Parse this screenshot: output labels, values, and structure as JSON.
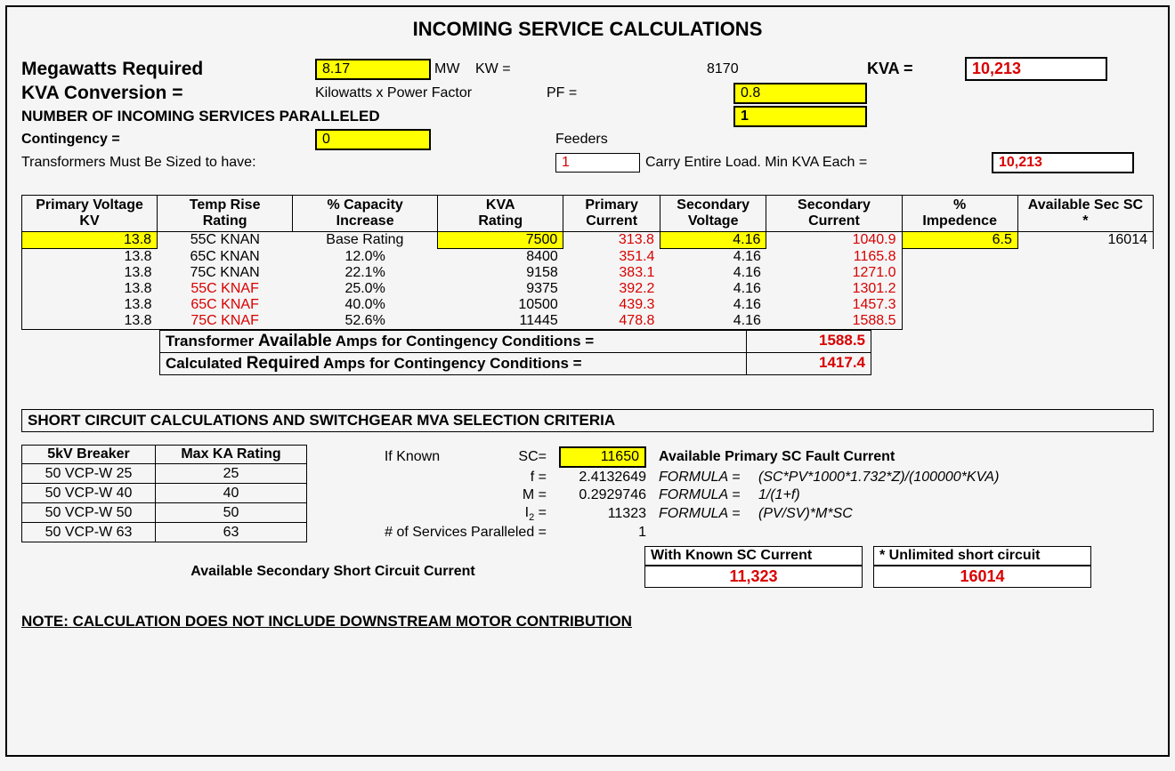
{
  "title": "INCOMING SERVICE CALCULATIONS",
  "inputs": {
    "mw_label": "Megawatts Required",
    "mw_value": "8.17",
    "mw_unit": "MW",
    "kw_label": "KW =",
    "kw_value": "8170",
    "kva_label": "KVA =",
    "kva_value": "10,213",
    "kva_conv_label": "KVA Conversion =",
    "kva_conv_formula": "Kilowatts x Power Factor",
    "pf_label": "PF =",
    "pf_value": "0.8",
    "parallel_label": "NUMBER OF INCOMING SERVICES PARALLELED",
    "parallel_value": "1",
    "contingency_label": "Contingency =",
    "contingency_value": "0",
    "feeders_label": "Feeders",
    "sized_label": "Transformers Must Be Sized to have:",
    "sized_value": "1",
    "sized_rest": "Carry Entire Load. Min KVA Each =",
    "sized_kva": "10,213"
  },
  "tfm": {
    "headers": [
      "Primary Voltage KV",
      "Temp Rise Rating",
      "% Capacity Increase",
      "KVA Rating",
      "Primary Current",
      "Secondary Voltage",
      "Secondary Current",
      "% Impedence",
      "Available Sec SC *"
    ],
    "rows": [
      {
        "pv": "13.8",
        "temp": "55C KNAN",
        "temp_red": false,
        "cap": "Base Rating",
        "kva": "7500",
        "pc": "313.8",
        "sv": "4.16",
        "sc": "1040.9",
        "imp": "6.5",
        "avail": "16014",
        "first": true
      },
      {
        "pv": "13.8",
        "temp": "65C KNAN",
        "temp_red": false,
        "cap": "12.0%",
        "kva": "8400",
        "pc": "351.4",
        "sv": "4.16",
        "sc": "1165.8"
      },
      {
        "pv": "13.8",
        "temp": "75C KNAN",
        "temp_red": false,
        "cap": "22.1%",
        "kva": "9158",
        "pc": "383.1",
        "sv": "4.16",
        "sc": "1271.0"
      },
      {
        "pv": "13.8",
        "temp": "55C KNAF",
        "temp_red": true,
        "cap": "25.0%",
        "kva": "9375",
        "pc": "392.2",
        "sv": "4.16",
        "sc": "1301.2"
      },
      {
        "pv": "13.8",
        "temp": "65C KNAF",
        "temp_red": true,
        "cap": "40.0%",
        "kva": "10500",
        "pc": "439.3",
        "sv": "4.16",
        "sc": "1457.3"
      },
      {
        "pv": "13.8",
        "temp": "75C KNAF",
        "temp_red": true,
        "cap": "52.6%",
        "kva": "11445",
        "pc": "478.8",
        "sv": "4.16",
        "sc": "1588.5"
      }
    ],
    "sum1_label_a": "Transformer ",
    "sum1_label_b": "Available",
    "sum1_label_c": " Amps for Contingency Conditions =",
    "sum1_val": "1588.5",
    "sum2_label_a": "Calculated ",
    "sum2_label_b": "Required",
    "sum2_label_c": " Amps for Contingency Conditions =",
    "sum2_val": "1417.4"
  },
  "sc": {
    "title": "SHORT CIRCUIT CALCULATIONS AND SWITCHGEAR MVA SELECTION CRITERIA",
    "breaker_headers": [
      "5kV Breaker",
      "Max KA Rating"
    ],
    "breakers": [
      {
        "name": "50 VCP-W 25",
        "ka": "25"
      },
      {
        "name": "50 VCP-W 40",
        "ka": "40"
      },
      {
        "name": "50 VCP-W 50",
        "ka": "50"
      },
      {
        "name": "50 VCP-W 63",
        "ka": "63"
      }
    ],
    "if_known": "If Known",
    "sc_lab": "SC=",
    "sc_val": "11650",
    "sc_desc": "Available Primary SC Fault Current",
    "f_lab": "f =",
    "f_val": "2.4132649",
    "f_formula": "FORMULA =",
    "f_eq": "(SC*PV*1000*1.732*Z)/(100000*KVA)",
    "m_lab": "M =",
    "m_val": "0.2929746",
    "m_formula": "FORMULA =",
    "m_eq": "1/(1+f)",
    "i2_val": "11323",
    "i2_formula": "FORMULA =",
    "i2_eq": "(PV/SV)*M*SC",
    "svc_lab": "# of Services Paralleled =",
    "svc_val": "1",
    "avail_sec_label": "Available Secondary Short Circuit Current",
    "known_header": "With Known SC Current",
    "unlim_header": "* Unlimited short circuit",
    "known_val": "11,323",
    "unlim_val": "16014"
  },
  "note": "NOTE: CALCULATION DOES NOT INCLUDE DOWNSTREAM MOTOR CONTRIBUTION"
}
